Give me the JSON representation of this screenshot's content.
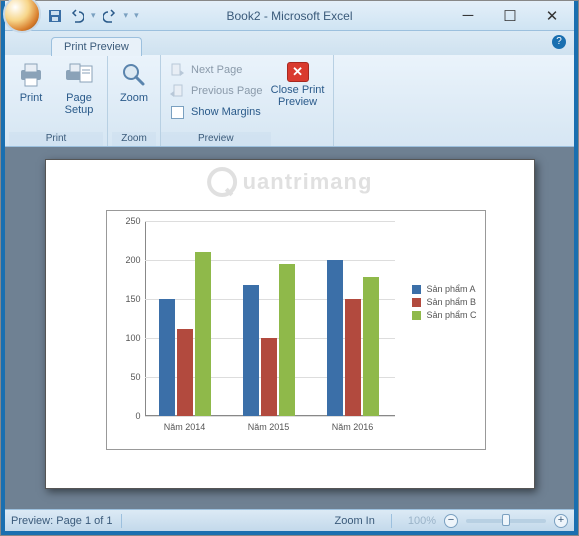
{
  "window": {
    "title": "Book2 - Microsoft Excel"
  },
  "qat": {
    "save": "save",
    "undo": "undo",
    "redo": "redo"
  },
  "tab": {
    "label": "Print Preview"
  },
  "ribbon": {
    "print_group": {
      "print": "Print",
      "page_setup": "Page Setup",
      "label": "Print"
    },
    "zoom_group": {
      "zoom": "Zoom",
      "label": "Zoom"
    },
    "preview_group": {
      "next_page": "Next Page",
      "previous_page": "Previous Page",
      "show_margins": "Show Margins",
      "close": "Close Print Preview",
      "label": "Preview"
    }
  },
  "watermark": "uantrimang",
  "chart_data": {
    "type": "bar",
    "categories": [
      "Năm 2014",
      "Năm 2015",
      "Năm 2016"
    ],
    "series": [
      {
        "name": "Sản phẩm A",
        "color": "#3b6fa8",
        "values": [
          150,
          168,
          200
        ]
      },
      {
        "name": "Sản phẩm B",
        "color": "#b24a3e",
        "values": [
          112,
          100,
          150
        ]
      },
      {
        "name": "Sản phẩm C",
        "color": "#8fb94a",
        "values": [
          210,
          195,
          178
        ]
      }
    ],
    "yticks": [
      0,
      50,
      100,
      150,
      200,
      250
    ],
    "ylim": [
      0,
      250
    ],
    "title": "",
    "xlabel": "",
    "ylabel": ""
  },
  "status": {
    "page": "Preview: Page 1 of 1",
    "zoom_label": "Zoom In",
    "zoom_pct": "100%"
  }
}
